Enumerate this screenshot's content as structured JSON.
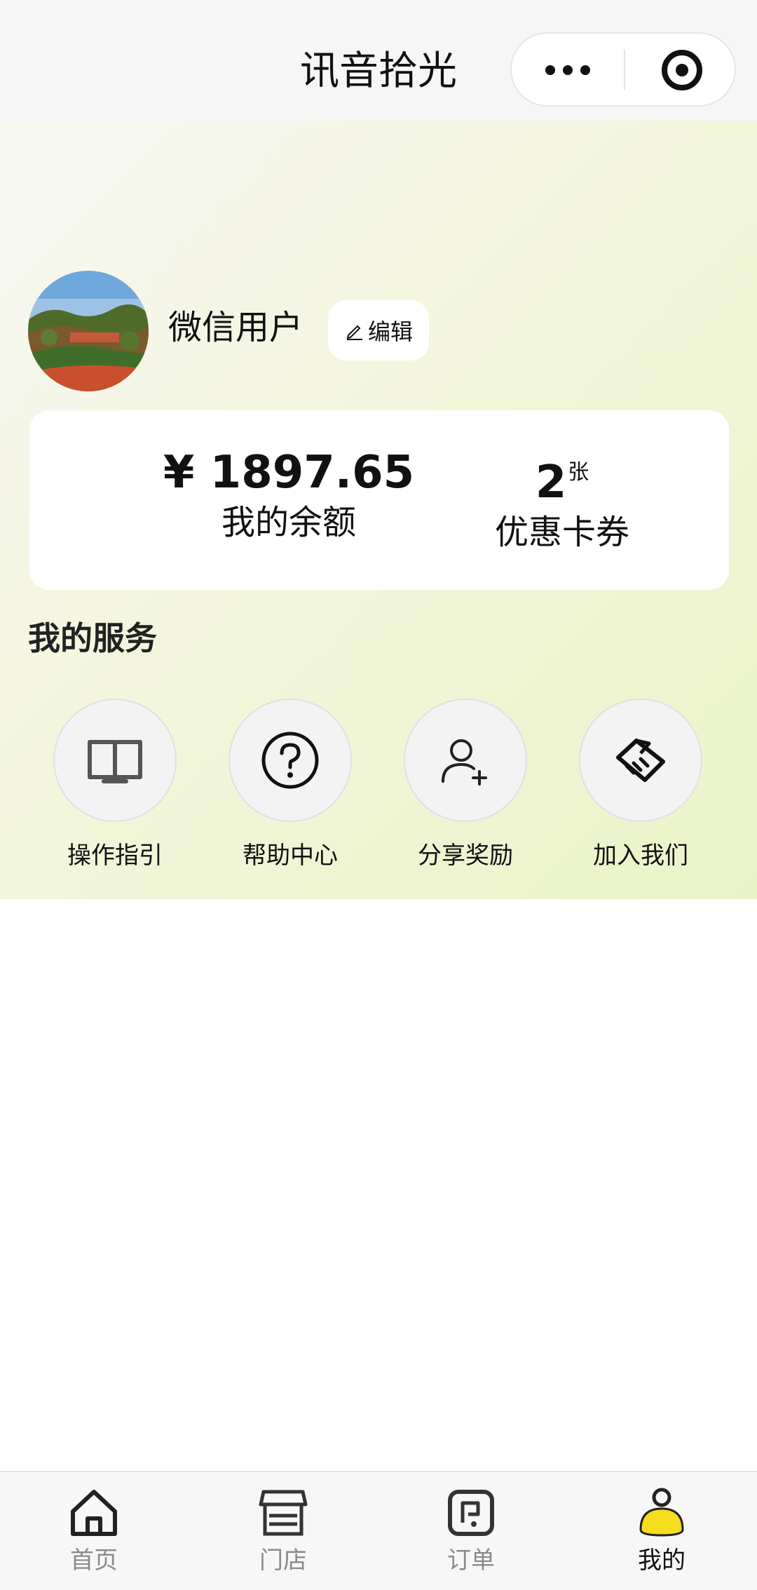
{
  "navbar": {
    "title": "讯音拾光",
    "more_icon": "more-dots-icon",
    "close_icon": "target-circle-icon"
  },
  "profile": {
    "username": "微信用户",
    "edit_label": "编辑",
    "edit_icon": "pencil-icon"
  },
  "wallet": {
    "balance_value": "¥ 1897.65",
    "balance_caption": "我的余额",
    "coupon_count": "2",
    "coupon_unit": "张",
    "coupon_caption": "优惠卡券"
  },
  "services": {
    "title": "我的服务",
    "items": [
      {
        "label": "操作指引",
        "icon": "open-book-icon"
      },
      {
        "label": "帮助中心",
        "icon": "question-circle-icon"
      },
      {
        "label": "分享奖励",
        "icon": "add-user-icon"
      },
      {
        "label": "加入我们",
        "icon": "handshake-icon"
      }
    ]
  },
  "tabbar": {
    "items": [
      {
        "label": "首页",
        "icon": "home-icon"
      },
      {
        "label": "门店",
        "icon": "store-icon"
      },
      {
        "label": "订单",
        "icon": "order-icon"
      },
      {
        "label": "我的",
        "icon": "profile-icon"
      }
    ],
    "active_index": 3,
    "active_color": "#f5dc1e"
  },
  "colors": {
    "hero_gradient_start": "#f7f7f3",
    "hero_gradient_end": "#eaf3c8",
    "tab_inactive": "#8a8a8a"
  }
}
